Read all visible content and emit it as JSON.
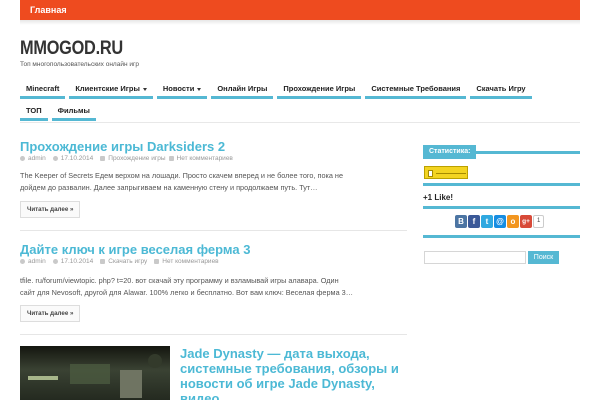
{
  "topbar": {
    "home": "Главная"
  },
  "site": {
    "title": "MMOGOD.RU",
    "description": "Топ многопользовательских онлайн игр"
  },
  "nav": {
    "row1": [
      {
        "label": "Minecraft",
        "dropdown": false
      },
      {
        "label": "Клиентские Игры",
        "dropdown": true
      },
      {
        "label": "Новости",
        "dropdown": true
      },
      {
        "label": "Онлайн Игры",
        "dropdown": false
      },
      {
        "label": "Прохождение Игры",
        "dropdown": false
      },
      {
        "label": "Системные Требования",
        "dropdown": false
      },
      {
        "label": "Скачать Игру",
        "dropdown": false
      }
    ],
    "row2": [
      {
        "label": "ТОП"
      },
      {
        "label": "Фильмы"
      }
    ]
  },
  "posts": [
    {
      "title": "Прохождение игры Darksiders 2",
      "author": "admin",
      "date": "17.10.2014",
      "category": "Прохождение игры",
      "comments": "Нет комментариев",
      "excerpt_line1": "The Keeper of Secrets Едем верхом на лошади. Просто скачем вперед и не более того, пока не",
      "excerpt_line2": "дойдем до развалин. Далее запрыгиваем на каменную стену и продолжаем путь. Тут…",
      "read_more": "Читать далее »"
    },
    {
      "title": "Дайте ключ к игре веселая ферма 3",
      "author": "admin",
      "date": "17.10.2014",
      "category": "Скачать игру",
      "comments": "Нет комментариев",
      "excerpt_line1": "tfile. ru/forum/viewtopic. php? t=20. вот скачай эту программу и взламывай игры алавара. Один",
      "excerpt_line2": "сайт для Nevosoft, другой для Alawar. 100% легко и бесплатно. Вот вам ключ: Веселая ферма 3…",
      "read_more": "Читать далее »"
    },
    {
      "title_line1": "Jade Dynasty — дата выхода,",
      "title_line2": "системные требования, обзоры и",
      "title_line3": "новости об игре Jade Dynasty,",
      "title_line4": "видео"
    }
  ],
  "sidebar": {
    "stats_title": "Статистика:",
    "like_title": "+1 Like!",
    "social": [
      {
        "letter": "В",
        "icon": "vk-icon",
        "color": "#4c75a3"
      },
      {
        "letter": "f",
        "icon": "facebook-icon",
        "color": "#3b5998"
      },
      {
        "letter": "t",
        "icon": "twitter-icon",
        "color": "#2fa8e0"
      },
      {
        "letter": "@",
        "icon": "mailru-icon",
        "color": "#168de2"
      },
      {
        "letter": "о",
        "icon": "odnoklassniki-icon",
        "color": "#f29620"
      },
      {
        "letter": "g+",
        "icon": "googleplus-icon",
        "color": "#d84a38"
      }
    ],
    "gplus_count": "1",
    "search_button": "Поиск"
  },
  "colors": {
    "accent": "#55b8d3",
    "topbar": "#ee4b1f",
    "title": "#4cb9d5"
  }
}
